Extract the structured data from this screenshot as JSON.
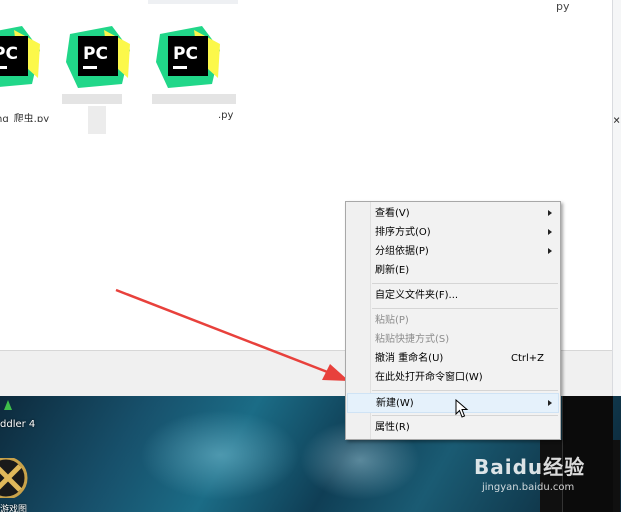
{
  "explorer": {
    "top_right_text": "py",
    "right_edge_glyph": "×",
    "files": [
      {
        "icon": "pycharm-icon",
        "icon_text": "PC",
        "caption": "hq_爬虫.py"
      },
      {
        "icon": "pycharm-icon",
        "icon_text": "PC",
        "caption": ""
      },
      {
        "icon": "pycharm-icon",
        "icon_text": "PC",
        "caption": ".py"
      }
    ]
  },
  "context_menu": {
    "items": [
      {
        "label": "查看(V)",
        "submenu": true,
        "enabled": true
      },
      {
        "label": "排序方式(O)",
        "submenu": true,
        "enabled": true
      },
      {
        "label": "分组依据(P)",
        "submenu": true,
        "enabled": true
      },
      {
        "label": "刷新(E)",
        "submenu": false,
        "enabled": true
      },
      {
        "label": "自定义文件夹(F)...",
        "submenu": false,
        "enabled": true
      },
      {
        "label": "粘贴(P)",
        "submenu": false,
        "enabled": false
      },
      {
        "label": "粘贴快捷方式(S)",
        "submenu": false,
        "enabled": false
      },
      {
        "label": "撤消 重命名(U)",
        "shortcut": "Ctrl+Z",
        "submenu": false,
        "enabled": true
      },
      {
        "label": "在此处打开命令窗口(W)",
        "submenu": false,
        "enabled": true
      },
      {
        "label": "新建(W)",
        "submenu": true,
        "enabled": true,
        "highlighted": true
      },
      {
        "label": "属性(R)",
        "submenu": false,
        "enabled": true
      }
    ]
  },
  "desktop": {
    "icon_label_1": "ddler 4",
    "icon_label_2": "游戏图"
  },
  "watermark": {
    "brand": "Baidu经验",
    "url": "jingyan.baidu.com"
  },
  "colors": {
    "menu_bg": "#f2f2f2",
    "menu_highlight": "#e5f1fb",
    "arrow": "#e8413c",
    "pycharm_green": "#21d789",
    "pycharm_yellow": "#fcf84a"
  }
}
